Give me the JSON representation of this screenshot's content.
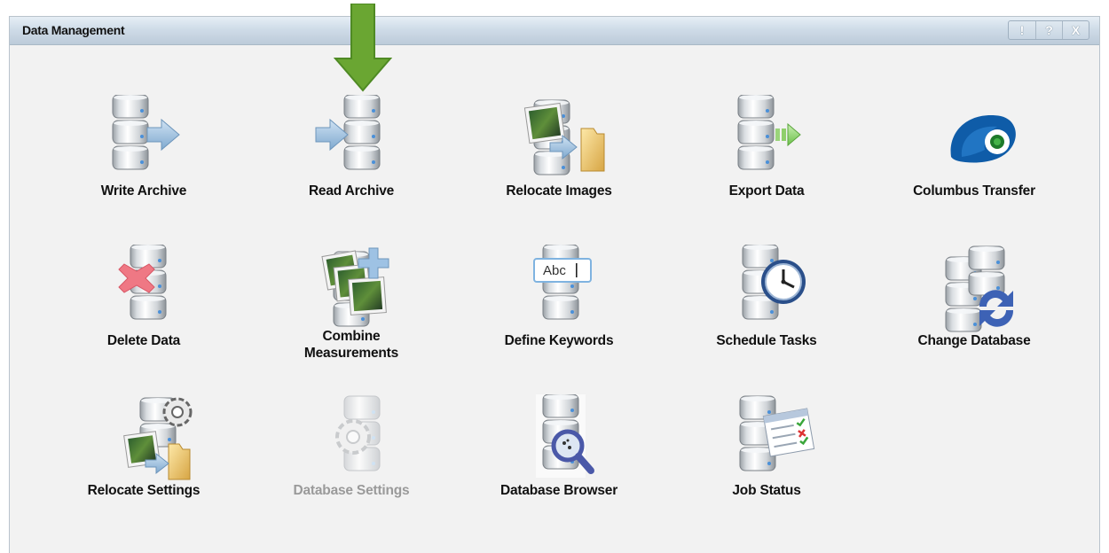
{
  "window": {
    "title": "Data Management",
    "buttons": {
      "info": "!",
      "help": "?",
      "close": "X"
    }
  },
  "tiles": [
    {
      "label": "Write Archive",
      "icon": "database-export-arrow-icon",
      "enabled": true
    },
    {
      "label": "Read Archive",
      "icon": "database-import-arrow-icon",
      "enabled": true
    },
    {
      "label": "Relocate Images",
      "icon": "relocate-images-icon",
      "enabled": true
    },
    {
      "label": "Export Data",
      "icon": "database-export-data-icon",
      "enabled": true
    },
    {
      "label": "Columbus Transfer",
      "icon": "columbus-logo-icon",
      "enabled": true
    },
    {
      "label": "Delete Data",
      "icon": "database-delete-icon",
      "enabled": true
    },
    {
      "label": "Combine\nMeasurements",
      "icon": "combine-measurements-icon",
      "enabled": true
    },
    {
      "label": "Define Keywords",
      "icon": "define-keywords-icon",
      "enabled": true
    },
    {
      "label": "Schedule Tasks",
      "icon": "schedule-clock-icon",
      "enabled": true
    },
    {
      "label": "Change Database",
      "icon": "change-database-icon",
      "enabled": true
    },
    {
      "label": "Relocate Settings",
      "icon": "relocate-settings-icon",
      "enabled": true
    },
    {
      "label": "Database Settings",
      "icon": "database-settings-gear-icon",
      "enabled": false
    },
    {
      "label": "Database Browser",
      "icon": "database-browser-magnifier-icon",
      "enabled": true
    },
    {
      "label": "Job Status",
      "icon": "job-status-checklist-icon",
      "enabled": true
    }
  ],
  "keywords_field_text": "Abc",
  "annotation": {
    "icon": "green-down-arrow-icon",
    "color": "#6aa632"
  },
  "colors": {
    "title_gradient": "#cfdce8",
    "panel_bg": "#f2f2f2",
    "disabled_text": "#9a9a9a"
  }
}
